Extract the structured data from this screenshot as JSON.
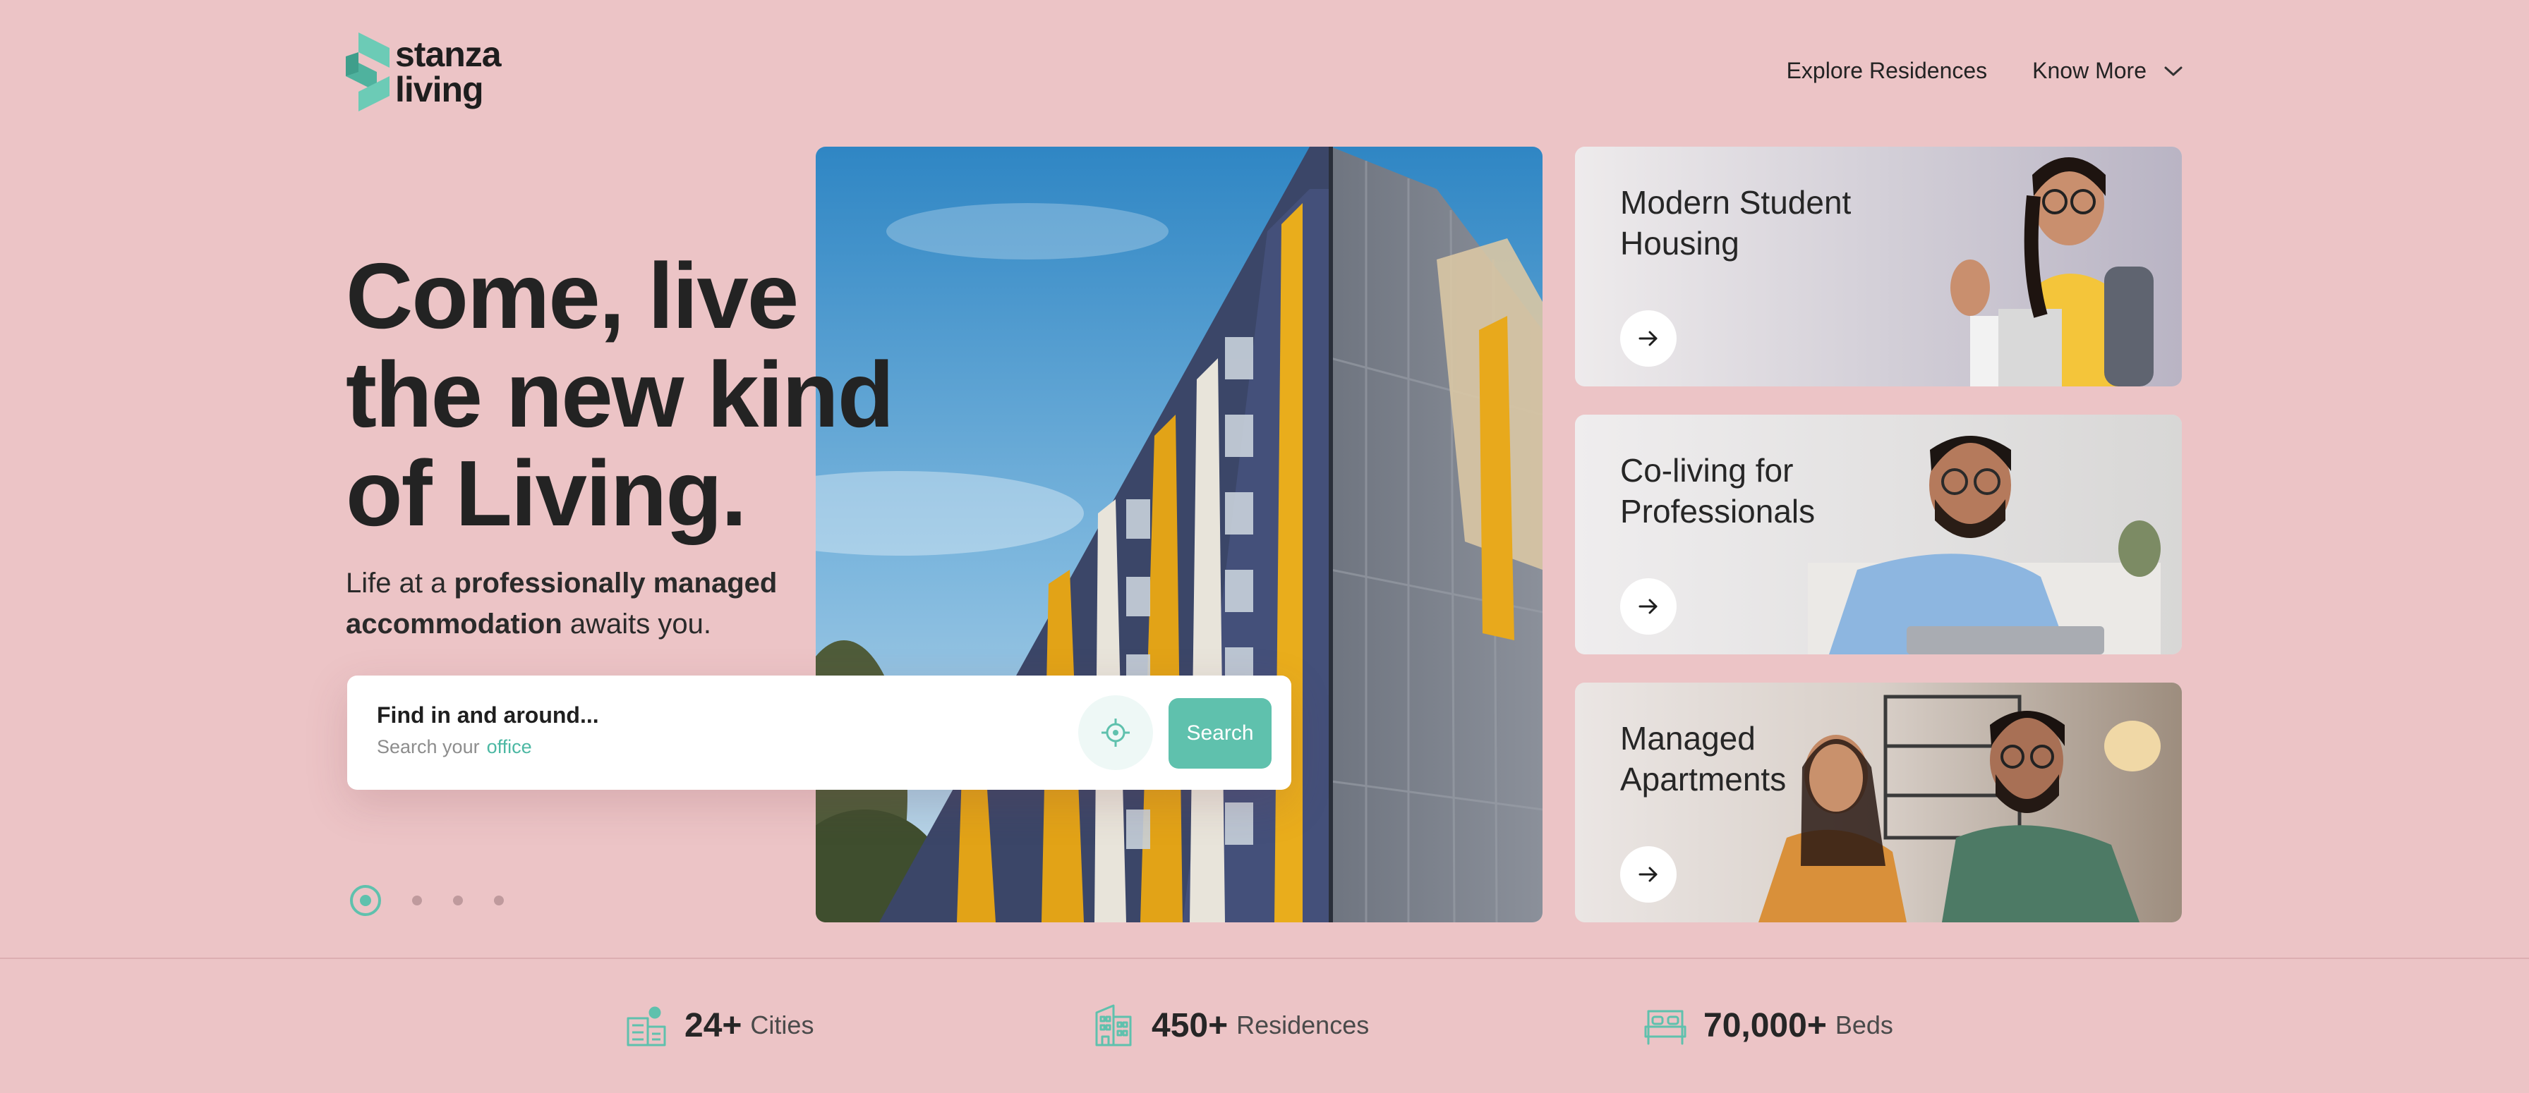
{
  "brand": {
    "line1": "stanza",
    "line2": "living",
    "accent": "#5fc1ad"
  },
  "nav": {
    "explore": "Explore Residences",
    "know_more": "Know More"
  },
  "hero": {
    "title_lines": [
      "Come, live",
      "the new kind",
      "of Living."
    ],
    "subtitle": {
      "pre": "Life at a ",
      "bold1": "professionally managed",
      "bold2": "accommodation",
      "post": " awaits you."
    }
  },
  "search": {
    "label": "Find in and around...",
    "hint": "Search your",
    "hint_keyword": "office",
    "button": "Search"
  },
  "carousel": {
    "total_slides": 4,
    "active_slide": 1
  },
  "cards": [
    {
      "line1": "Modern Student",
      "line2": "Housing"
    },
    {
      "line1": "Co-living for",
      "line2": "Professionals"
    },
    {
      "line1": "Managed",
      "line2": "Apartments"
    }
  ],
  "stats": [
    {
      "number": "24+",
      "label": "Cities",
      "icon": "city-icon"
    },
    {
      "number": "450+",
      "label": "Residences",
      "icon": "building-icon"
    },
    {
      "number": "70,000+",
      "label": "Beds",
      "icon": "bed-icon"
    }
  ],
  "colors": {
    "background": "#ecc4c6",
    "accent": "#5fc1ad",
    "text": "#232323"
  }
}
